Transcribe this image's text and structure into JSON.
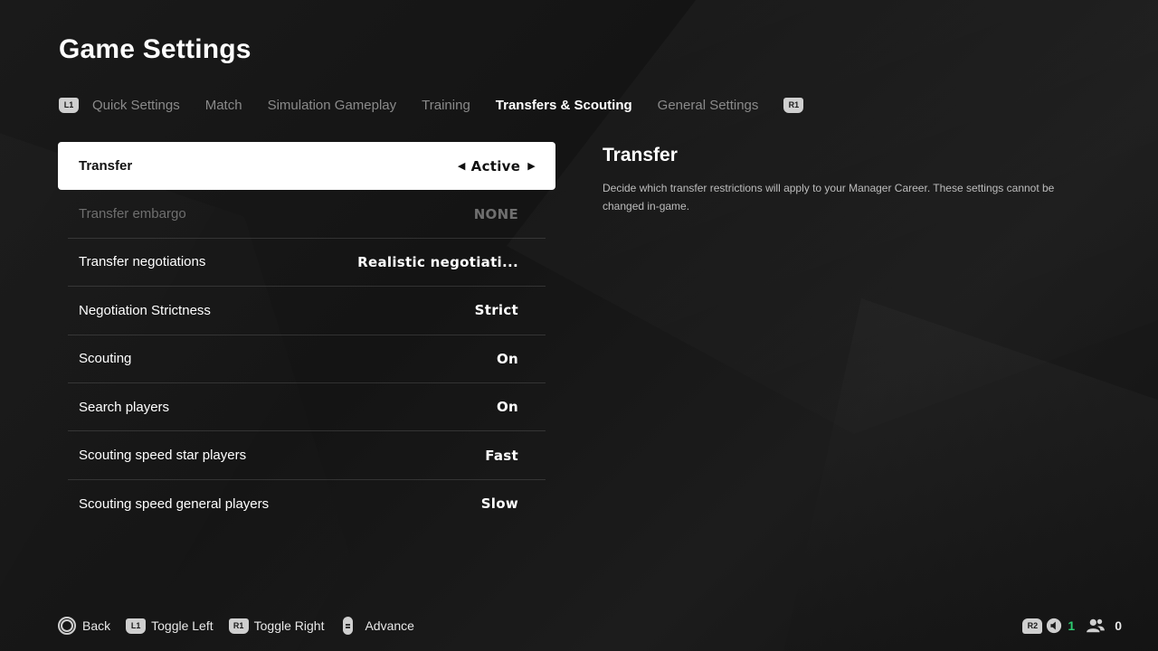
{
  "page": {
    "title": "Game Settings"
  },
  "tabs": {
    "left_shoulder": "L1",
    "right_shoulder": "R1",
    "items": [
      {
        "label": "Quick Settings",
        "active": false
      },
      {
        "label": "Match",
        "active": false
      },
      {
        "label": "Simulation Gameplay",
        "active": false
      },
      {
        "label": "Training",
        "active": false
      },
      {
        "label": "Transfers & Scouting",
        "active": true
      },
      {
        "label": "General Settings",
        "active": false
      }
    ]
  },
  "settings": [
    {
      "label": "Transfer",
      "value": "Active",
      "state": "selected"
    },
    {
      "label": "Transfer embargo",
      "value": "NONE",
      "state": "disabled"
    },
    {
      "label": "Transfer negotiations",
      "value": "Realistic negotiati...",
      "state": "normal"
    },
    {
      "label": "Negotiation Strictness",
      "value": "Strict",
      "state": "normal"
    },
    {
      "label": "Scouting",
      "value": "On",
      "state": "normal"
    },
    {
      "label": "Search players",
      "value": "On",
      "state": "normal"
    },
    {
      "label": "Scouting speed star players",
      "value": "Fast",
      "state": "normal"
    },
    {
      "label": "Scouting speed general players",
      "value": "Slow",
      "state": "normal"
    }
  ],
  "detail": {
    "title": "Transfer",
    "description": "Decide which transfer restrictions will apply to your Manager Career. These settings cannot be changed in-game."
  },
  "footer": {
    "back": "Back",
    "toggle_left_key": "L1",
    "toggle_left": "Toggle Left",
    "toggle_right_key": "R1",
    "toggle_right": "Toggle Right",
    "advance": "Advance"
  },
  "status": {
    "r2_key": "R2",
    "voice_count": "1",
    "party_count": "0"
  },
  "colors": {
    "background": "#161616",
    "selected_row": "#ffffff",
    "active_tab": "#ffffff",
    "inactive_tab": "#8a8a8a",
    "voice_count": "#2ecc71"
  }
}
